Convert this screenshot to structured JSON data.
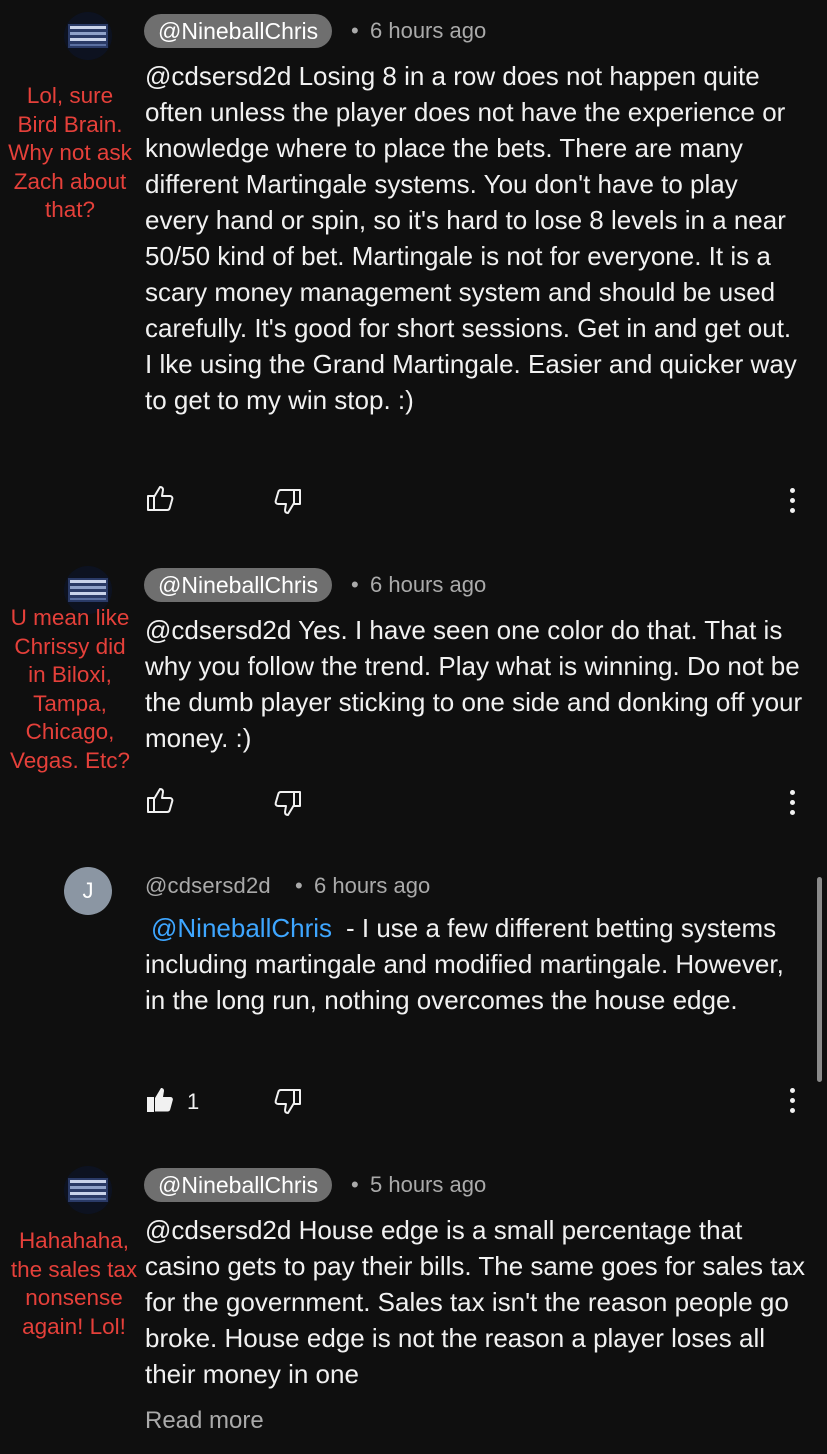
{
  "comments": [
    {
      "author": "@NineballChris",
      "time": "6 hours ago",
      "text": "@cdsersd2d Losing 8 in a row does not happen quite often unless the player does not have the experience or knowledge where to place the bets. There are many different Martingale systems. You don't have to play every hand or spin, so it's hard to lose 8 levels in a near 50/50 kind of bet. Martingale is not for everyone. It is a scary money management system and should be used carefully. It's good for short sessions. Get in and get out. I lke using the Grand Martingale. Easier and quicker way to get to my win stop. :)",
      "annotation": "Lol, sure Bird Brain. Why not ask Zach about that?"
    },
    {
      "author": "@NineballChris",
      "time": "6 hours ago",
      "text": "@cdsersd2d Yes. I have seen one color do that. That is why you follow the trend. Play what is winning. Do not be the dumb player sticking to one side and donking off your money. :)",
      "annotation": "U mean like Chrissy did in Biloxi, Tampa, Chicago, Vegas. Etc?"
    },
    {
      "author": "@cdsersd2d",
      "avatar_letter": "J",
      "time": "6 hours ago",
      "mention": "@NineballChris",
      "text": "- I use a few different betting systems including martingale and modified martingale.  However, in the long run, nothing overcomes the house edge.",
      "like_count": "1"
    },
    {
      "author": "@NineballChris",
      "time": "5 hours ago",
      "text": "@cdsersd2d House edge is a small percentage that casino gets to pay their bills. The same goes for sales tax for the government. Sales tax isn't the reason people go broke. House edge is not the reason a player loses all their money in one",
      "annotation": "Hahahaha, the sales tax nonsense again! Lol!",
      "read_more": "Read more"
    }
  ],
  "separator": "•",
  "icons": [
    "avatar-image",
    "thumbs-up-icon",
    "thumbs-down-icon",
    "more-vertical-icon",
    "thumbs-up-filled-icon"
  ],
  "colors": {
    "background": "#0f0f0f",
    "mention": "#3ea6ff",
    "annotation": "#e5403a",
    "chip": "#6f6f6f"
  }
}
